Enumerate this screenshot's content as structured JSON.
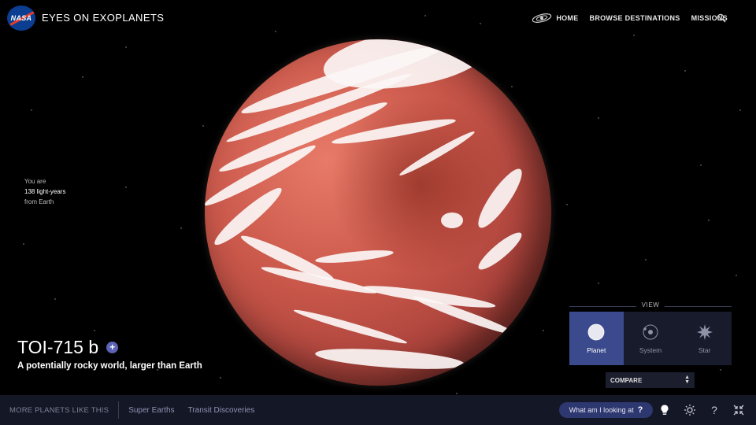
{
  "header": {
    "logo_text": "NASA",
    "app_title": "EYES ON EXOPLANETS",
    "nav": {
      "home": "HOME",
      "browse": "BROWSE DESTINATIONS",
      "missions": "MISSIONS"
    }
  },
  "distance": {
    "line1": "You are",
    "line2": "138 light-years",
    "line3": "from Earth"
  },
  "planet": {
    "name": "TOI-715 b",
    "description": "A potentially rocky world, larger than Earth",
    "colors": {
      "surface": "#c9574a",
      "clouds": "#fbf6f5"
    }
  },
  "view": {
    "label": "VIEW",
    "options": [
      {
        "label": "Planet",
        "active": true
      },
      {
        "label": "System",
        "active": false
      },
      {
        "label": "Star",
        "active": false
      }
    ],
    "compare_label": "COMPARE"
  },
  "bottom_bar": {
    "more_label": "MORE PLANETS LIKE THIS",
    "links": [
      "Super Earths",
      "Transit Discoveries"
    ],
    "help_button": "What am I looking at",
    "accent": "#2d3770"
  }
}
